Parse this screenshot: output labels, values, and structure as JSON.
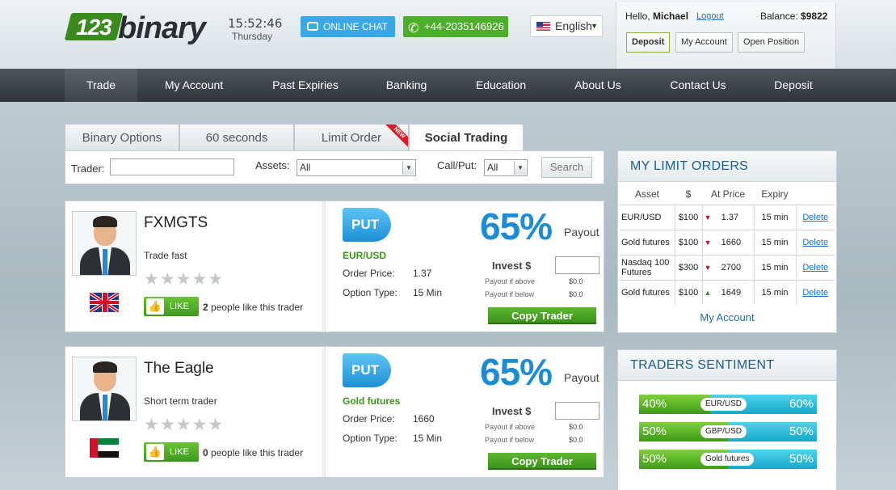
{
  "brand": {
    "number": "123",
    "word": "binary"
  },
  "clock": {
    "time": "15:52:46",
    "day": "Thursday"
  },
  "header": {
    "chat_label": "ONLINE CHAT",
    "phone_label": "+44-2035146926",
    "language": "English"
  },
  "account": {
    "hello_prefix": "Hello,",
    "user": "Michael",
    "logout": "Logout",
    "balance_label": "Balance:",
    "balance_value": "$9822",
    "deposit": "Deposit",
    "my_account": "My Account",
    "open_position": "Open Position"
  },
  "nav": [
    "Trade",
    "My Account",
    "Past Expiries",
    "Banking",
    "Education",
    "About Us",
    "Contact Us",
    "Deposit"
  ],
  "tabs": {
    "t0": "Binary Options",
    "t1": "60 seconds",
    "t2": "Limit Order",
    "t3": "Social Trading",
    "new_badge": "NEW"
  },
  "filter": {
    "trader_label": "Trader:",
    "assets_label": "Assets:",
    "assets_value": "All",
    "callput_label": "Call/Put:",
    "callput_value": "All",
    "search": "Search"
  },
  "traders": [
    {
      "name": "FXMGTS",
      "desc": "Trade fast",
      "stars": "★★★★★",
      "like": "LIKE",
      "likes": "2",
      "likes_suffix": "people like this trader",
      "direction": "PUT",
      "asset": "EUR/USD",
      "order_price_label": "Order Price:",
      "order_price": "1.37",
      "option_type_label": "Option Type:",
      "option_type": "15 Min",
      "payout_pct": "65%",
      "payout_label": "Payout",
      "invest_label": "Invest $",
      "above_label": "Payout if above",
      "above_val": "$0.0",
      "below_label": "Payout if below",
      "below_val": "$0.0",
      "copy": "Copy Trader"
    },
    {
      "name": "The Eagle",
      "desc": "Short term trader",
      "stars": "★★★★★",
      "like": "LIKE",
      "likes": "0",
      "likes_suffix": "people like this trader",
      "direction": "PUT",
      "asset": "Gold futures",
      "order_price_label": "Order Price:",
      "order_price": "1660",
      "option_type_label": "Option Type:",
      "option_type": "15 Min",
      "payout_pct": "65%",
      "payout_label": "Payout",
      "invest_label": "Invest $",
      "above_label": "Payout if above",
      "above_val": "$0.0",
      "below_label": "Payout if below",
      "below_val": "$0.0",
      "copy": "Copy Trader"
    }
  ],
  "limit_orders": {
    "title": "MY LIMIT ORDERS",
    "headers": [
      "Asset",
      "$",
      "At Price",
      "Expiry"
    ],
    "rows": [
      {
        "asset": "EUR/USD",
        "amount": "$100",
        "dir": "▼",
        "price": "1.37",
        "expiry": "15 min",
        "action": "Delete"
      },
      {
        "asset": "Gold futures",
        "amount": "$100",
        "dir": "▼",
        "price": "1660",
        "expiry": "15 min",
        "action": "Delete"
      },
      {
        "asset": "Nasdaq 100 Futures",
        "amount": "$300",
        "dir": "▼",
        "price": "2700",
        "expiry": "15 min",
        "action": "Delete"
      },
      {
        "asset": "Gold futures",
        "amount": "$100",
        "dir": "▲",
        "price": "1649",
        "expiry": "15 min",
        "action": "Delete"
      }
    ],
    "my_account_link": "My Account"
  },
  "sentiment": {
    "title": "TRADERS SENTIMENT",
    "rows": [
      {
        "left": "40%",
        "asset": "EUR/USD",
        "right": "60%",
        "call_share": 0.4
      },
      {
        "left": "50%",
        "asset": "GBP/USD",
        "right": "50%",
        "call_share": 0.5
      },
      {
        "left": "50%",
        "asset": "Gold futures",
        "right": "50%",
        "call_share": 0.5
      }
    ]
  },
  "colors": {
    "nav_bg": "#2f353a",
    "accent_blue": "#1c8cd6",
    "accent_green": "#3b9418",
    "put_red": "#d0112a"
  }
}
